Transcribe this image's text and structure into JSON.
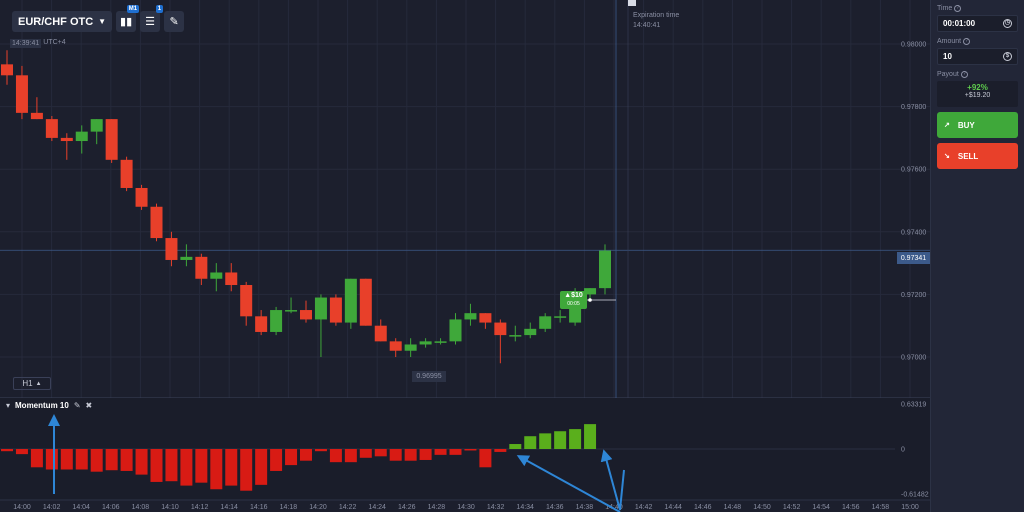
{
  "toolbar": {
    "pair_label": "EUR/CHF OTC",
    "chart_type_badge": "M1",
    "indicator_badge": "1",
    "time": "14:39:41",
    "timezone": "UTC+4"
  },
  "expiration": {
    "label": "Expiration time",
    "time": "14:40:41"
  },
  "timeframe": {
    "label": "H1"
  },
  "current_price": "0.97341",
  "low_price_label": "0.96995",
  "trade_marker": {
    "amount": "$10",
    "timer": "00:05"
  },
  "indicator": {
    "name": "Momentum 10"
  },
  "sidebar": {
    "time_label": "Time",
    "time_value": "00:01:00",
    "amount_label": "Amount",
    "amount_value": "10",
    "payout_label": "Payout",
    "payout_pct": "+92%",
    "payout_profit": "+$19.20",
    "buy_label": "BUY",
    "sell_label": "SELL"
  },
  "colors": {
    "bull": "#3fa83a",
    "bear": "#e8402a",
    "momentum_up": "#5aaf1c",
    "momentum_down": "#d81b14",
    "annotation": "#2e86d6"
  },
  "chart_data": {
    "type": "candlestick",
    "price_axis": {
      "ticks": [
        "0.98000",
        "0.97800",
        "0.97600",
        "0.97400",
        "0.97200",
        "0.97000"
      ]
    },
    "momentum_axis": {
      "ticks": [
        "0.63319",
        "0",
        "-0.61482"
      ]
    },
    "time_ticks": [
      "14:00",
      "14:02",
      "14:04",
      "14:06",
      "14:08",
      "14:10",
      "14:12",
      "14:14",
      "14:16",
      "14:18",
      "14:20",
      "14:22",
      "14:24",
      "14:26",
      "14:28",
      "14:30",
      "14:32",
      "14:34",
      "14:36",
      "14:38",
      "14:40",
      "14:42",
      "14:44",
      "14:46",
      "14:48",
      "14:50",
      "14:52",
      "14:54",
      "14:56",
      "14:58",
      "15:00"
    ],
    "candles": [
      [
        0.97935,
        0.9798,
        0.9787,
        0.979
      ],
      [
        0.979,
        0.9793,
        0.9776,
        0.9778
      ],
      [
        0.9778,
        0.9783,
        0.9776,
        0.9776
      ],
      [
        0.9776,
        0.9777,
        0.9769,
        0.977
      ],
      [
        0.977,
        0.97715,
        0.9763,
        0.9769
      ],
      [
        0.9769,
        0.9774,
        0.9765,
        0.9772
      ],
      [
        0.9772,
        0.9776,
        0.9768,
        0.9776
      ],
      [
        0.9776,
        0.9776,
        0.9762,
        0.9763
      ],
      [
        0.9763,
        0.9764,
        0.9753,
        0.9754
      ],
      [
        0.9754,
        0.9755,
        0.9747,
        0.9748
      ],
      [
        0.9748,
        0.9749,
        0.9737,
        0.9738
      ],
      [
        0.9738,
        0.974,
        0.9729,
        0.9731
      ],
      [
        0.9731,
        0.9736,
        0.9729,
        0.9732
      ],
      [
        0.9732,
        0.9733,
        0.9723,
        0.9725
      ],
      [
        0.9725,
        0.973,
        0.9721,
        0.9727
      ],
      [
        0.9727,
        0.973,
        0.9721,
        0.9723
      ],
      [
        0.9723,
        0.9724,
        0.971,
        0.9713
      ],
      [
        0.9713,
        0.9715,
        0.9707,
        0.9708
      ],
      [
        0.9708,
        0.9716,
        0.9707,
        0.9715
      ],
      [
        0.9715,
        0.9719,
        0.9714,
        0.9715
      ],
      [
        0.9715,
        0.9718,
        0.9711,
        0.9712
      ],
      [
        0.9712,
        0.972,
        0.97,
        0.9719
      ],
      [
        0.9719,
        0.972,
        0.971,
        0.9711
      ],
      [
        0.9711,
        0.9725,
        0.9709,
        0.9725
      ],
      [
        0.9725,
        0.9725,
        0.971,
        0.971
      ],
      [
        0.971,
        0.9712,
        0.9705,
        0.9705
      ],
      [
        0.9705,
        0.9706,
        0.97,
        0.9702
      ],
      [
        0.9702,
        0.9706,
        0.97,
        0.9704
      ],
      [
        0.9704,
        0.9706,
        0.9703,
        0.9705
      ],
      [
        0.9705,
        0.9706,
        0.9704,
        0.9705
      ],
      [
        0.9705,
        0.9714,
        0.9704,
        0.9712
      ],
      [
        0.9712,
        0.9717,
        0.971,
        0.9714
      ],
      [
        0.9714,
        0.9714,
        0.9709,
        0.9711
      ],
      [
        0.9711,
        0.9712,
        0.9698,
        0.9707
      ],
      [
        0.9707,
        0.971,
        0.9705,
        0.9707
      ],
      [
        0.9707,
        0.9711,
        0.9706,
        0.9709
      ],
      [
        0.9709,
        0.9714,
        0.9708,
        0.9713
      ],
      [
        0.9713,
        0.9715,
        0.9711,
        0.9713
      ],
      [
        0.9711,
        0.9722,
        0.971,
        0.972
      ],
      [
        0.972,
        0.9722,
        0.9718,
        0.9722
      ],
      [
        0.9722,
        0.9736,
        0.972,
        0.9734
      ]
    ],
    "momentum": [
      -0.03,
      -0.07,
      -0.25,
      -0.28,
      -0.28,
      -0.28,
      -0.31,
      -0.29,
      -0.3,
      -0.35,
      -0.45,
      -0.44,
      -0.5,
      -0.46,
      -0.55,
      -0.5,
      -0.57,
      -0.49,
      -0.3,
      -0.22,
      -0.16,
      -0.03,
      -0.18,
      -0.18,
      -0.12,
      -0.1,
      -0.16,
      -0.16,
      -0.15,
      -0.08,
      -0.08,
      -0.02,
      -0.25,
      -0.04,
      0.07,
      0.18,
      0.22,
      0.25,
      0.28,
      0.35
    ]
  }
}
